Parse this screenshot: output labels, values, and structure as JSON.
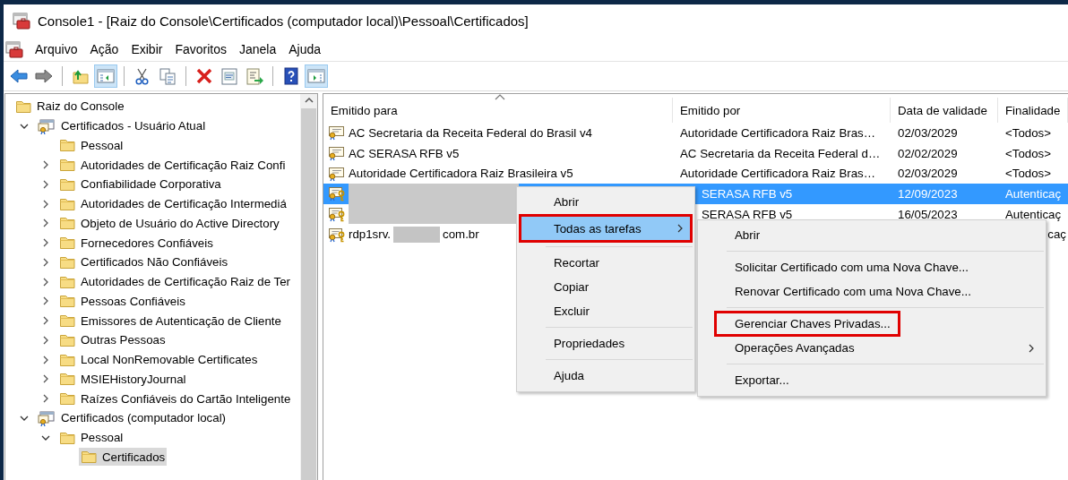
{
  "window": {
    "title": "Console1 - [Raiz do Console\\Certificados (computador local)\\Pessoal\\Certificados]"
  },
  "menu_bar": [
    "Arquivo",
    "Ação",
    "Exibir",
    "Favoritos",
    "Janela",
    "Ajuda"
  ],
  "toolbar": [
    {
      "kind": "back",
      "pressed": false
    },
    {
      "kind": "forward",
      "pressed": false
    },
    {
      "kind": "separator"
    },
    {
      "kind": "up",
      "pressed": false
    },
    {
      "kind": "tree",
      "pressed": true
    },
    {
      "kind": "separator"
    },
    {
      "kind": "cut",
      "pressed": false
    },
    {
      "kind": "copy",
      "pressed": false
    },
    {
      "kind": "separator"
    },
    {
      "kind": "delete",
      "pressed": false
    },
    {
      "kind": "properties",
      "pressed": false
    },
    {
      "kind": "export",
      "pressed": false
    },
    {
      "kind": "separator"
    },
    {
      "kind": "help",
      "pressed": false
    },
    {
      "kind": "actions",
      "pressed": true
    }
  ],
  "tree": {
    "items": [
      {
        "label": "Raiz do Console",
        "kind": "folder",
        "selected": false,
        "children": [
          {
            "label": "Certificados - Usuário Atual",
            "kind": "store",
            "expanded": true,
            "selected": false,
            "children": [
              {
                "label": "Pessoal",
                "kind": "folder",
                "selected": false
              },
              {
                "label": "Autoridades de Certificação Raiz Confi",
                "kind": "folder",
                "expanded": false,
                "selected": false
              },
              {
                "label": "Confiabilidade Corporativa",
                "kind": "folder",
                "expanded": false,
                "selected": false
              },
              {
                "label": "Autoridades de Certificação Intermediá",
                "kind": "folder",
                "expanded": false,
                "selected": false
              },
              {
                "label": "Objeto de Usuário do Active Directory",
                "kind": "folder",
                "expanded": false,
                "selected": false
              },
              {
                "label": "Fornecedores Confiáveis",
                "kind": "folder",
                "expanded": false,
                "selected": false
              },
              {
                "label": "Certificados Não Confiáveis",
                "kind": "folder",
                "expanded": false,
                "selected": false
              },
              {
                "label": "Autoridades de Certificação Raiz de Ter",
                "kind": "folder",
                "expanded": false,
                "selected": false
              },
              {
                "label": "Pessoas Confiáveis",
                "kind": "folder",
                "expanded": false,
                "selected": false
              },
              {
                "label": "Emissores de Autenticação de Cliente",
                "kind": "folder",
                "expanded": false,
                "selected": false
              },
              {
                "label": "Outras Pessoas",
                "kind": "folder",
                "expanded": false,
                "selected": false
              },
              {
                "label": "Local NonRemovable Certificates",
                "kind": "folder",
                "expanded": false,
                "selected": false
              },
              {
                "label": "MSIEHistoryJournal",
                "kind": "folder",
                "expanded": false,
                "selected": false
              },
              {
                "label": "Raízes Confiáveis do Cartão Inteligente",
                "kind": "folder",
                "expanded": false,
                "selected": false
              }
            ]
          },
          {
            "label": "Certificados (computador local)",
            "kind": "store",
            "expanded": true,
            "selected": false,
            "children": [
              {
                "label": "Pessoal",
                "kind": "folder",
                "expanded": true,
                "selected": false,
                "children": [
                  {
                    "label": "Certificados",
                    "kind": "folder",
                    "selected": true
                  }
                ]
              }
            ]
          }
        ]
      }
    ]
  },
  "table": {
    "columns": [
      "Emitido para",
      "Emitido por",
      "Data de validade",
      "Finalidade"
    ],
    "rows": [
      {
        "name": [
          {
            "kind": "text",
            "text": "AC Secretaria da Receita Federal do Brasil v4"
          }
        ],
        "has_key": false,
        "selected": false,
        "issued_by": "Autoridade Certificadora Raiz Bras…",
        "expires": "02/03/2029",
        "purpose": "<Todos>"
      },
      {
        "name": [
          {
            "kind": "text",
            "text": "AC SERASA RFB v5"
          }
        ],
        "has_key": false,
        "selected": false,
        "issued_by": "AC Secretaria da Receita Federal d…",
        "expires": "02/02/2029",
        "purpose": "<Todos>"
      },
      {
        "name": [
          {
            "kind": "text",
            "text": "Autoridade Certificadora Raiz Brasileira v5"
          }
        ],
        "has_key": false,
        "selected": false,
        "issued_by": "Autoridade Certificadora Raiz Bras…",
        "expires": "02/03/2029",
        "purpose": "<Todos>"
      },
      {
        "name": [
          {
            "kind": "redacted"
          }
        ],
        "has_key": true,
        "selected": true,
        "issued_by": "SERASA RFB v5",
        "expires": "12/09/2023",
        "purpose": "Autenticaç"
      },
      {
        "name": [
          {
            "kind": "redacted"
          }
        ],
        "has_key": true,
        "selected": false,
        "issued_by": "SERASA RFB v5",
        "expires": "16/05/2023",
        "purpose": "Autenticaç"
      },
      {
        "name": [
          {
            "kind": "text",
            "text": "rdp1srv."
          },
          {
            "kind": "redacted"
          },
          {
            "kind": "text",
            "text": "com.br"
          }
        ],
        "has_key": true,
        "selected": false,
        "purpose": "caç"
      }
    ]
  },
  "context_menu": {
    "items": [
      {
        "kind": "item",
        "label": "Abrir",
        "selected": false,
        "outlined": false,
        "submenu": false
      },
      {
        "kind": "item",
        "label": "Todas as tarefas",
        "selected": true,
        "outlined": true,
        "submenu": true
      },
      {
        "kind": "separator"
      },
      {
        "kind": "item",
        "label": "Recortar",
        "selected": false,
        "outlined": false,
        "submenu": false
      },
      {
        "kind": "item",
        "label": "Copiar",
        "selected": false,
        "outlined": false,
        "submenu": false
      },
      {
        "kind": "item",
        "label": "Excluir",
        "selected": false,
        "outlined": false,
        "submenu": false
      },
      {
        "kind": "separator"
      },
      {
        "kind": "item",
        "label": "Propriedades",
        "selected": false,
        "outlined": false,
        "submenu": false
      },
      {
        "kind": "separator"
      },
      {
        "kind": "item",
        "label": "Ajuda",
        "selected": false,
        "outlined": false,
        "submenu": false
      }
    ]
  },
  "submenu": {
    "items": [
      {
        "kind": "item",
        "label": "Abrir",
        "selected": false,
        "outlined": false,
        "submenu": false
      },
      {
        "kind": "separator"
      },
      {
        "kind": "item",
        "label": "Solicitar Certificado com uma Nova Chave...",
        "selected": false,
        "outlined": false,
        "submenu": false
      },
      {
        "kind": "item",
        "label": "Renovar Certificado com uma Nova Chave...",
        "selected": false,
        "outlined": false,
        "submenu": false
      },
      {
        "kind": "separator"
      },
      {
        "kind": "item",
        "label": "Gerenciar Chaves Privadas...",
        "selected": false,
        "outlined": true,
        "submenu": false
      },
      {
        "kind": "item",
        "label": "Operações Avançadas",
        "selected": false,
        "outlined": false,
        "submenu": true
      },
      {
        "kind": "separator"
      },
      {
        "kind": "item",
        "label": "Exportar...",
        "selected": false,
        "outlined": false,
        "submenu": false
      }
    ]
  }
}
